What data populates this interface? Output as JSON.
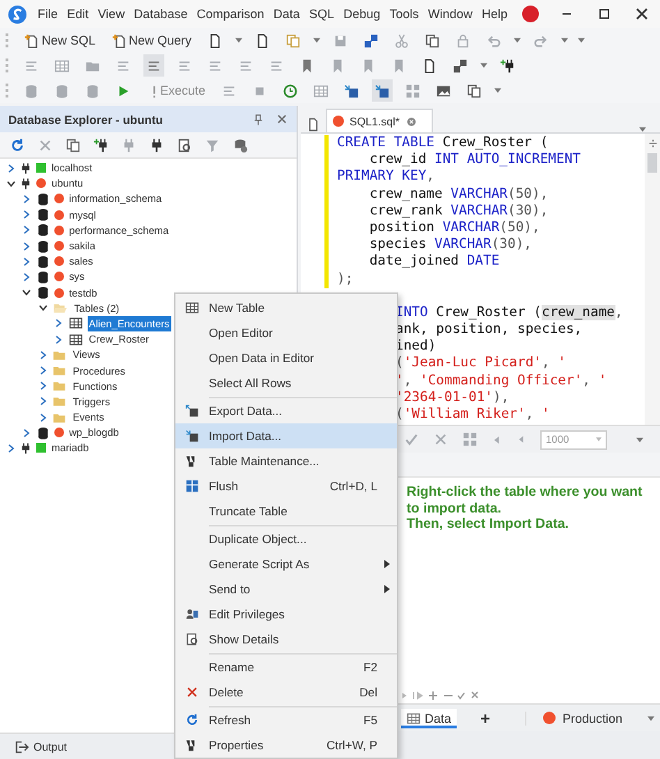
{
  "window": {
    "menu": [
      "File",
      "Edit",
      "View",
      "Database",
      "Comparison",
      "Data",
      "SQL",
      "Debug",
      "Tools",
      "Window",
      "Help"
    ]
  },
  "toolbar": {
    "new_sql": "New SQL",
    "new_query": "New Query",
    "execute": "Execute"
  },
  "explorer": {
    "title": "Database Explorer - ubuntu",
    "tree": [
      {
        "kind": "server",
        "label": "localhost",
        "color": "#2fc02f",
        "expanded": false,
        "selected": false
      },
      {
        "kind": "server",
        "label": "ubuntu",
        "color": "#f0502e",
        "expanded": true,
        "selected": false,
        "children": [
          {
            "kind": "database",
            "label": "information_schema",
            "color": "#f0502e",
            "expanded": false,
            "selected": false
          },
          {
            "kind": "database",
            "label": "mysql",
            "color": "#f0502e",
            "expanded": false,
            "selected": false
          },
          {
            "kind": "database",
            "label": "performance_schema",
            "color": "#f0502e",
            "expanded": false,
            "selected": false
          },
          {
            "kind": "database",
            "label": "sakila",
            "color": "#f0502e",
            "expanded": false,
            "selected": false
          },
          {
            "kind": "database",
            "label": "sales",
            "color": "#f0502e",
            "expanded": false,
            "selected": false
          },
          {
            "kind": "database",
            "label": "sys",
            "color": "#f0502e",
            "expanded": false,
            "selected": false
          },
          {
            "kind": "database",
            "label": "testdb",
            "color": "#f0502e",
            "expanded": true,
            "selected": false,
            "children": [
              {
                "kind": "folder",
                "label": "Tables (2)",
                "expanded": true,
                "selected": false,
                "children": [
                  {
                    "kind": "table",
                    "label": "Alien_Encounters",
                    "expanded": false,
                    "selected": true
                  },
                  {
                    "kind": "table",
                    "label": "Crew_Roster",
                    "expanded": false,
                    "selected": false
                  }
                ]
              },
              {
                "kind": "folder",
                "label": "Views",
                "expanded": false,
                "selected": false
              },
              {
                "kind": "folder",
                "label": "Procedures",
                "expanded": false,
                "selected": false
              },
              {
                "kind": "folder",
                "label": "Functions",
                "expanded": false,
                "selected": false
              },
              {
                "kind": "folder",
                "label": "Triggers",
                "expanded": false,
                "selected": false
              },
              {
                "kind": "folder",
                "label": "Events",
                "expanded": false,
                "selected": false
              }
            ]
          },
          {
            "kind": "database",
            "label": "wp_blogdb",
            "color": "#f0502e",
            "expanded": false,
            "selected": false
          }
        ]
      },
      {
        "kind": "server",
        "label": "mariadb",
        "color": "#2fc02f",
        "expanded": false,
        "selected": false
      }
    ]
  },
  "output": {
    "label": "Output"
  },
  "editor": {
    "tab": {
      "label": "SQL1.sql*"
    },
    "blocks": [
      {
        "modified": true,
        "partly_hidden": false,
        "lines": [
          [
            {
              "kind": "keyword",
              "text": "CREATE TABLE"
            },
            {
              "kind": "ident",
              "text": " Crew_Roster ("
            }
          ],
          [
            {
              "kind": "ident",
              "text": "    crew_id "
            },
            {
              "kind": "keyword",
              "text": "INT AUTO_INCREMENT"
            }
          ],
          [
            {
              "kind": "keyword",
              "text": "PRIMARY KEY"
            },
            {
              "kind": "punct",
              "text": ","
            }
          ],
          [
            {
              "kind": "ident",
              "text": "    crew_name "
            },
            {
              "kind": "keyword",
              "text": "VARCHAR"
            },
            {
              "kind": "punct",
              "text": "(50),"
            }
          ],
          [
            {
              "kind": "ident",
              "text": "    crew_rank "
            },
            {
              "kind": "keyword",
              "text": "VARCHAR"
            },
            {
              "kind": "punct",
              "text": "(30),"
            }
          ],
          [
            {
              "kind": "ident",
              "text": "    position "
            },
            {
              "kind": "keyword",
              "text": "VARCHAR"
            },
            {
              "kind": "punct",
              "text": "(50),"
            }
          ],
          [
            {
              "kind": "ident",
              "text": "    species "
            },
            {
              "kind": "keyword",
              "text": "VARCHAR"
            },
            {
              "kind": "punct",
              "text": "(30),"
            }
          ],
          [
            {
              "kind": "ident",
              "text": "    date_joined "
            },
            {
              "kind": "keyword",
              "text": "DATE"
            }
          ],
          [
            {
              "kind": "punct",
              "text": ");"
            }
          ]
        ]
      },
      {
        "modified": false,
        "partly_hidden": true,
        "lines": [
          [
            {
              "kind": "keyword",
              "text": "INTO"
            },
            {
              "kind": "ident",
              "text": " Crew_Roster ("
            },
            {
              "kind": "match",
              "text": "crew_name"
            },
            {
              "kind": "punct",
              "text": ","
            }
          ],
          [
            {
              "kind": "ident",
              "text": "ank, position, species,"
            }
          ],
          [
            {
              "kind": "ident",
              "text": "ined)"
            }
          ],
          [
            {
              "kind": "punct",
              "text": "("
            },
            {
              "kind": "string",
              "text": "'Jean-Luc Picard'"
            },
            {
              "kind": "punct",
              "text": ", "
            },
            {
              "kind": "string",
              "text": "'"
            }
          ],
          [
            {
              "kind": "string",
              "text": "'"
            },
            {
              "kind": "punct",
              "text": ", "
            },
            {
              "kind": "string",
              "text": "'Commanding Officer'"
            },
            {
              "kind": "punct",
              "text": ", "
            },
            {
              "kind": "string",
              "text": "'"
            }
          ],
          [
            {
              "kind": "string",
              "text": "'2364-01-01'"
            },
            {
              "kind": "punct",
              "text": "),"
            }
          ],
          [
            {
              "kind": "punct",
              "text": "("
            },
            {
              "kind": "string",
              "text": "'William Riker'"
            },
            {
              "kind": "punct",
              "text": ", "
            },
            {
              "kind": "string",
              "text": "'"
            }
          ]
        ]
      }
    ]
  },
  "results": {
    "limit": "1000",
    "message": [
      "Right-click the table where you want to import data.",
      "Then, select Import Data."
    ],
    "tabs": [
      {
        "label": "Data",
        "selected": true
      }
    ],
    "add_tab": "+",
    "connection": {
      "label": "Production",
      "color": "#f0502e"
    }
  },
  "context_menu": {
    "items": [
      {
        "kind": "item",
        "label": "New Table",
        "selected": false,
        "has_submenu": false
      },
      {
        "kind": "item",
        "label": "Open Editor",
        "selected": false,
        "has_submenu": false
      },
      {
        "kind": "item",
        "label": "Open Data in Editor",
        "selected": false,
        "has_submenu": false
      },
      {
        "kind": "item",
        "label": "Select All Rows",
        "selected": false,
        "has_submenu": false
      },
      {
        "kind": "separator"
      },
      {
        "kind": "item",
        "label": "Export Data...",
        "selected": false,
        "has_submenu": false
      },
      {
        "kind": "item",
        "label": "Import Data...",
        "selected": true,
        "has_submenu": false
      },
      {
        "kind": "item",
        "label": "Table Maintenance...",
        "selected": false,
        "has_submenu": false
      },
      {
        "kind": "item",
        "label": "Flush",
        "shortcut": "Ctrl+D, L",
        "selected": false,
        "has_submenu": false
      },
      {
        "kind": "item",
        "label": "Truncate Table",
        "selected": false,
        "has_submenu": false
      },
      {
        "kind": "separator"
      },
      {
        "kind": "item",
        "label": "Duplicate Object...",
        "selected": false,
        "has_submenu": false
      },
      {
        "kind": "item",
        "label": "Generate Script As",
        "selected": false,
        "has_submenu": true
      },
      {
        "kind": "item",
        "label": "Send to",
        "selected": false,
        "has_submenu": true
      },
      {
        "kind": "item",
        "label": "Edit Privileges",
        "selected": false,
        "has_submenu": false
      },
      {
        "kind": "item",
        "label": "Show Details",
        "selected": false,
        "has_submenu": false
      },
      {
        "kind": "separator"
      },
      {
        "kind": "item",
        "label": "Rename",
        "shortcut": "F2",
        "selected": false,
        "has_submenu": false
      },
      {
        "kind": "item",
        "label": "Delete",
        "shortcut": "Del",
        "selected": false,
        "has_submenu": false
      },
      {
        "kind": "separator"
      },
      {
        "kind": "item",
        "label": "Refresh",
        "shortcut": "F5",
        "selected": false,
        "has_submenu": false
      },
      {
        "kind": "item",
        "label": "Properties",
        "shortcut": "Ctrl+W, P",
        "selected": false,
        "has_submenu": false
      }
    ]
  }
}
